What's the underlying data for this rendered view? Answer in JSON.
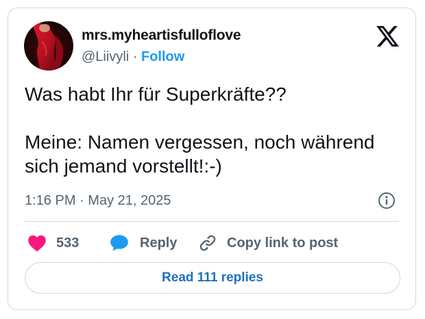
{
  "author": {
    "display_name": "mrs.myheartisfulloflove",
    "handle": "@Liivyli",
    "separator": "·",
    "follow_label": "Follow"
  },
  "tweet": {
    "line1": "Was habt Ihr für Superkräfte??",
    "line2": "Meine: Namen vergessen, noch während sich jemand vorstellt!:-)"
  },
  "meta": {
    "time": "1:16 PM",
    "separator": "·",
    "date": "May 21, 2025"
  },
  "actions": {
    "like_count": "533",
    "reply_label": "Reply",
    "copy_label": "Copy link to post"
  },
  "read_replies_label": "Read 111 replies",
  "icons": {
    "brand": "x-logo-icon",
    "info": "info-icon",
    "like": "heart-icon",
    "reply": "speech-bubble-icon",
    "copy": "link-icon"
  },
  "colors": {
    "accent": "#1d9bf0",
    "like": "#f91880",
    "muted": "#536471",
    "text": "#0f1419",
    "border": "#cfd9de"
  }
}
